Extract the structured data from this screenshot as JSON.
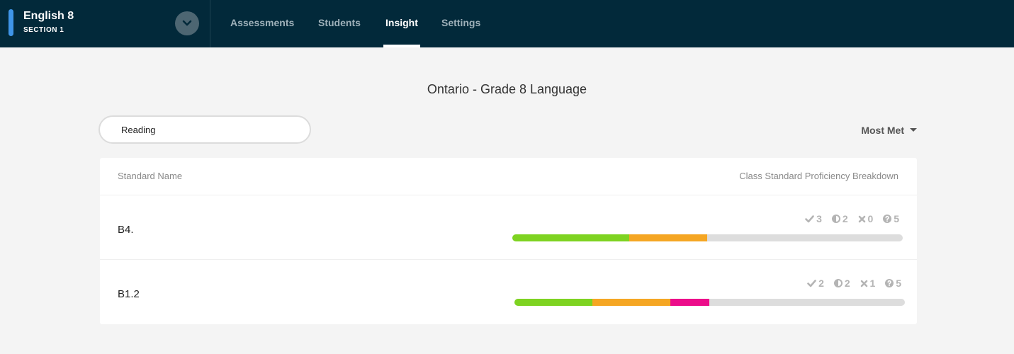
{
  "course": {
    "title": "English 8",
    "section": "SECTION 1"
  },
  "nav": {
    "tabs": [
      {
        "label": "Assessments",
        "active": false
      },
      {
        "label": "Students",
        "active": false
      },
      {
        "label": "Insight",
        "active": true
      },
      {
        "label": "Settings",
        "active": false
      }
    ]
  },
  "page": {
    "heading": "Ontario - Grade 8 Language"
  },
  "filter": {
    "search_value": "Reading"
  },
  "sort": {
    "label": "Most Met"
  },
  "table": {
    "col_name": "Standard Name",
    "col_breakdown": "Class Standard Proficiency Breakdown",
    "rows": [
      {
        "name": "B4.",
        "met": "3",
        "partial": "2",
        "not_met": "0",
        "unknown": "5",
        "fractions": {
          "met": 0.3,
          "partial": 0.2,
          "not_met": 0.0
        }
      },
      {
        "name": "B1.2",
        "met": "2",
        "partial": "2",
        "not_met": "1",
        "unknown": "5",
        "fractions": {
          "met": 0.2,
          "partial": 0.2,
          "not_met": 0.1
        }
      }
    ]
  },
  "colors": {
    "met": "#7ed321",
    "partial": "#f5a623",
    "not_met": "#ec0d8a",
    "unknown": "#dddddd",
    "topbar": "#02293a",
    "accent": "#3f95e8"
  },
  "icons": {
    "met": "checkmark-icon",
    "partial": "half-circle-icon",
    "not_met": "x-icon",
    "unknown": "question-icon"
  }
}
